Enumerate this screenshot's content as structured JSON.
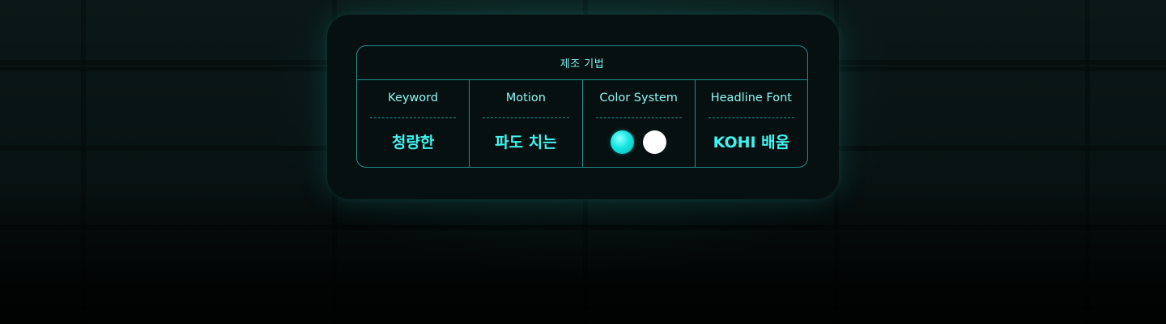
{
  "panel": {
    "title": "제조 기법",
    "columns": [
      {
        "label": "Keyword",
        "value": "청량한"
      },
      {
        "label": "Motion",
        "value": "파도 치는"
      },
      {
        "label": "Color System",
        "colors": [
          "#14e6e2",
          "#ffffff"
        ]
      },
      {
        "label": "Headline Font",
        "value": "KOHI 배움"
      }
    ]
  },
  "colors": {
    "accent": "#3ff4f0",
    "border": "#1f8e8a",
    "card_background": "#061010"
  }
}
